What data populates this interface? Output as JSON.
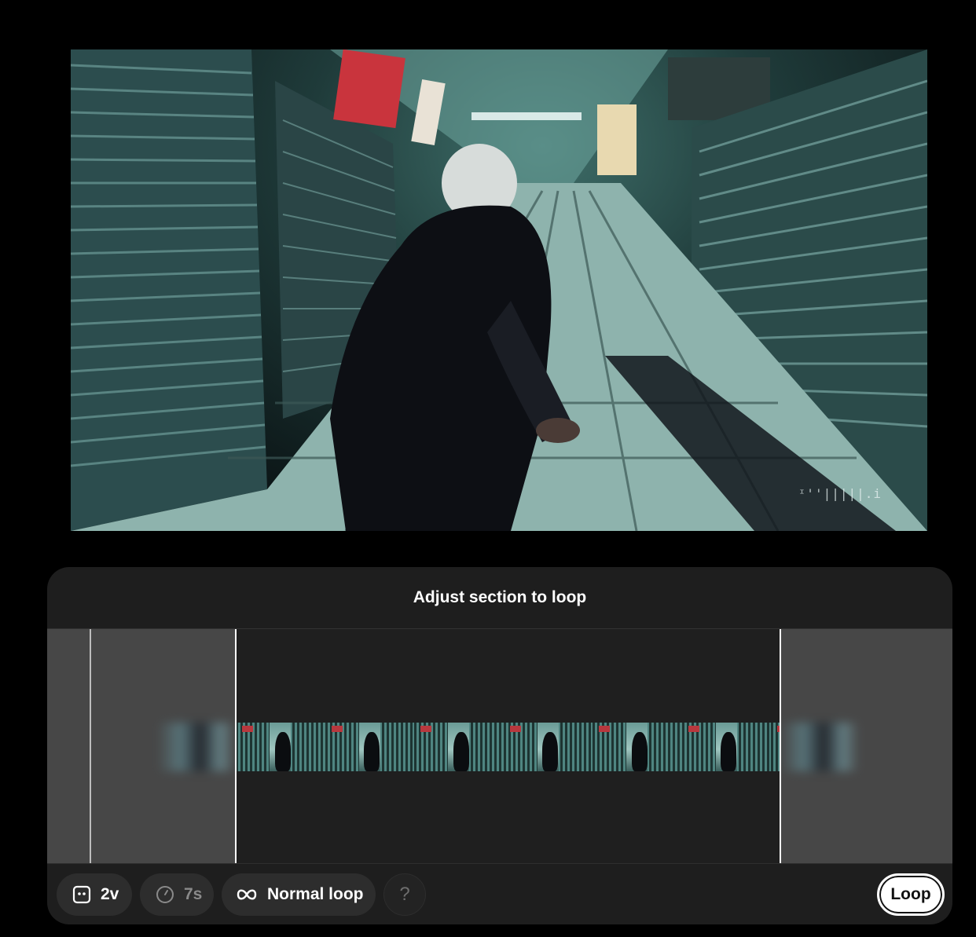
{
  "video": {
    "watermark": "ᶦ''|||||.i"
  },
  "panel": {
    "title": "Adjust section to loop"
  },
  "toolbar": {
    "version_label": "2v",
    "duration_label": "7s",
    "mode_label": "Normal loop",
    "help_label": "?",
    "loop_button": "Loop"
  },
  "timeline": {
    "frame_count": 7
  },
  "colors": {
    "panel_bg": "#1e1e1e",
    "pill_bg": "#2d2d2d",
    "dim_region": "#474747",
    "accent_white": "#ffffff"
  },
  "icons": {
    "version": "face-square-icon",
    "duration": "clock-icon",
    "mode": "infinity-icon"
  }
}
